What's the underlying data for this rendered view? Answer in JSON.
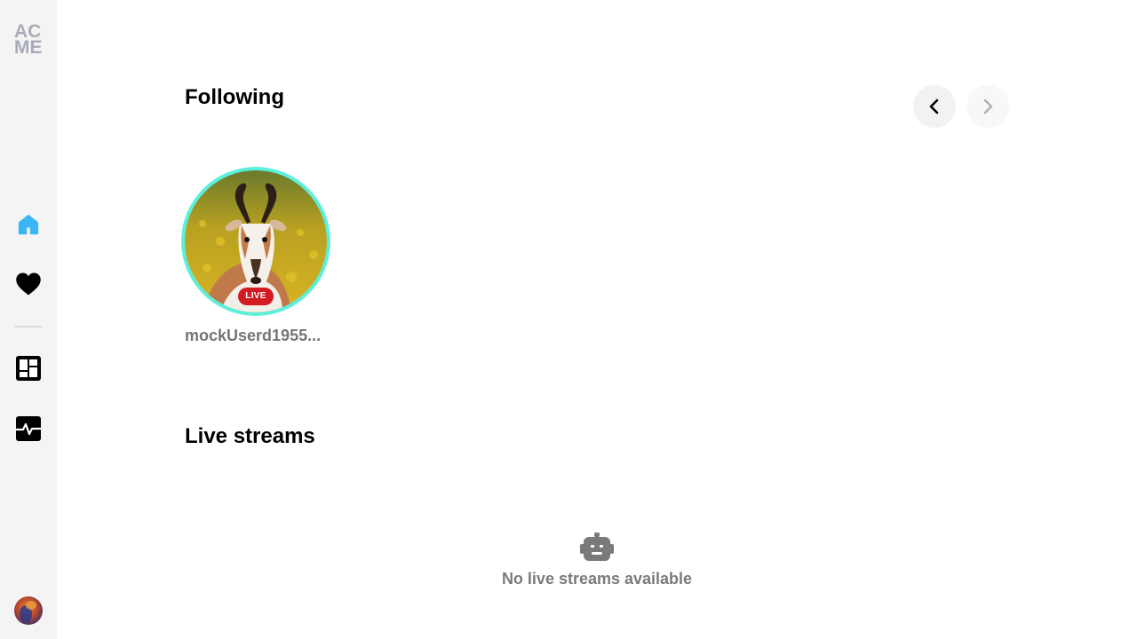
{
  "sidebar": {
    "logo_top": "AC",
    "logo_bottom": "ME",
    "items": [
      {
        "id": "home",
        "icon": "home-icon",
        "active": true
      },
      {
        "id": "favorites",
        "icon": "heart-icon",
        "active": false
      },
      {
        "id": "dashboard",
        "icon": "dashboard-icon",
        "active": false
      },
      {
        "id": "activity",
        "icon": "activity-icon",
        "active": false
      }
    ],
    "avatar_icon": "user-avatar"
  },
  "following": {
    "title": "Following",
    "channels": [
      {
        "name": "mockUserd1955...",
        "badge": "LIVE"
      }
    ]
  },
  "live_streams": {
    "title": "Live streams",
    "empty_icon": "robot-icon",
    "empty_text": "No live streams available"
  },
  "colors": {
    "sidebar_bg": "#f4f4f4",
    "accent_home": "#3bb5f5",
    "live_ring": "#5cf0dc",
    "live_badge": "#d41a22",
    "muted_text": "#757575"
  }
}
